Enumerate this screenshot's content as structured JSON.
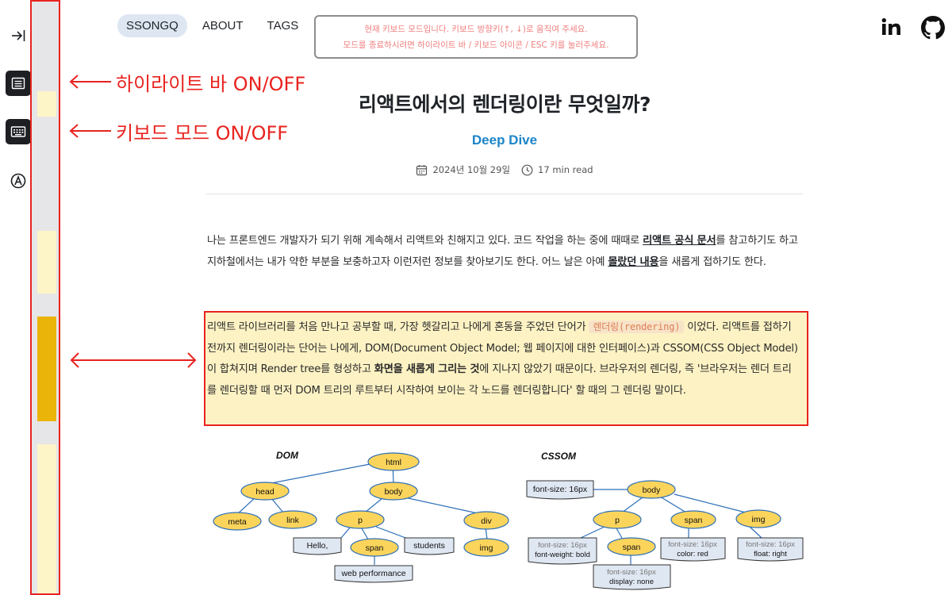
{
  "nav": {
    "items": [
      {
        "label": "SSONGQ",
        "active": true
      },
      {
        "label": "ABOUT",
        "active": false
      },
      {
        "label": "TAGS",
        "active": false
      }
    ]
  },
  "keyboard_notice": {
    "line1": "현재 키보드 모드입니다. 키보드 방향키(↑, ↓)로 움직여 주세요.",
    "line2": "모드를 종료하시려면 하이라이트 바 / 키보드 아이콘 / ESC 키를 눌러주세요."
  },
  "annotations": {
    "highlight_bar": "하이라이트 바 ON/OFF",
    "keyboard_mode": "키보드 모드 ON/OFF"
  },
  "post": {
    "title": "리액트에서의 렌더링이란 무엇일까?",
    "category": "Deep Dive",
    "date": "2024년 10월 29일",
    "read_time": "17 min read"
  },
  "paragraph1": {
    "part1": "나는 프론트엔드 개발자가 되기 위해 계속해서 리액트와 친해지고 있다. 코드 작업을 하는 중에 때때로 ",
    "link1": "리액트 공식 문서",
    "part2": "를 참고하기도 하고 지하철에서는 내가 약한 부분을 보충하고자 이런저런 정보를 찾아보기도 한다. 어느 날은 아예 ",
    "link2": "몰랐던 내용",
    "part3": "을 새롭게 접하기도 한다."
  },
  "paragraph2": {
    "part1": "리액트 라이브러리를 처음 만나고 공부할 때, 가장 헷갈리고 나에게 혼동을 주었던 단어가 ",
    "code": "렌더링(rendering)",
    "part2": " 이었다. 리액트를 접하기 전까지 렌더링이라는 단어는 나에게, DOM(Document Object Model; 웹 페이지에 대한 인터페이스)과 CSSOM(CSS Object Model)이 합쳐지며 Render tree를 형성하고 ",
    "bold": "화면을 새롭게 그리는 것",
    "part3": "에 지나지 않았기 때문이다. 브라우저의 렌더링, 즉 '브라우저는 렌더 트리를 렌더링할 때 먼저 DOM 트리의 루트부터 시작하여 보이는 각 노드를 렌더링합니다' 할 때의 그 렌더링 말이다."
  },
  "dom_diagram": {
    "title": "DOM",
    "nodes": [
      "html",
      "head",
      "body",
      "meta",
      "link",
      "p",
      "div",
      "Hello,",
      "span",
      "students",
      "img",
      "web performance"
    ]
  },
  "cssom_diagram": {
    "title": "CSSOM",
    "nodes": [
      "body",
      "font-size: 16px",
      "p",
      "span",
      "img",
      "span"
    ],
    "notes": {
      "body": "font-size: 16px",
      "p_1": "font-size: 16px",
      "p_2": "font-weight: bold",
      "span_1": "font-size: 16px",
      "span_2": "color: red",
      "img_1": "font-size: 16px",
      "img_2": "float: right",
      "span2_1": "font-size: 16px",
      "span2_2": "display: none"
    }
  },
  "highlight_strips": [
    {
      "color": "#fdf5c7",
      "level": "low"
    },
    {
      "color": "#fdf5c7",
      "level": "low"
    },
    {
      "color": "#ebb409",
      "level": "active"
    },
    {
      "color": "#fdf5c7",
      "level": "low"
    }
  ],
  "colors": {
    "annotation": "#e8231f",
    "accent": "#1b85c8",
    "highlight_active": "#ebb409",
    "highlight_soft": "#fdf5c7",
    "node_fill": "#fbd45c",
    "note_fill": "#dfe7f2"
  }
}
